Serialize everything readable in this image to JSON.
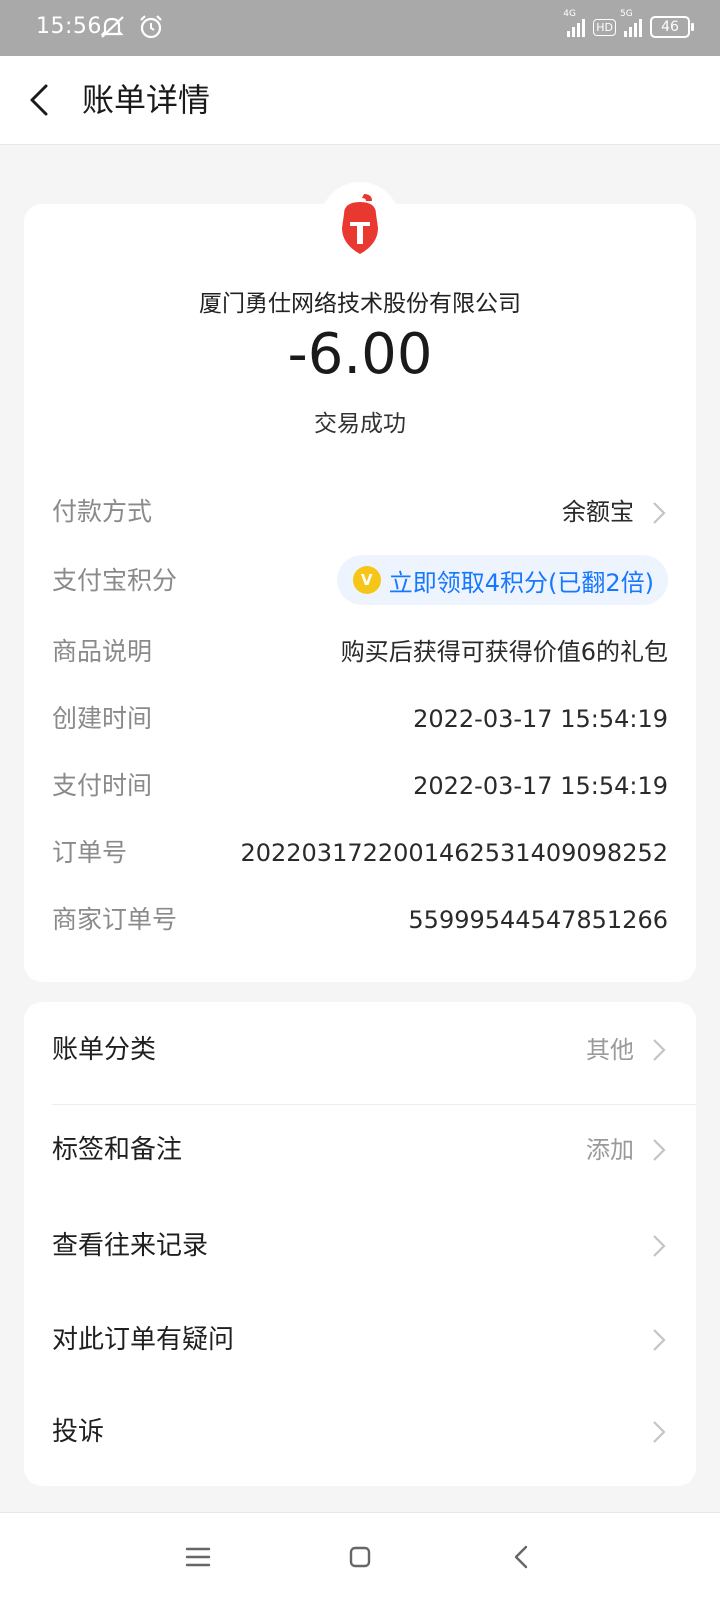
{
  "status_bar": {
    "time": "15:56",
    "network_1": "4G",
    "hd_badge": "HD",
    "network_2": "5G",
    "battery": "46",
    "icons": [
      "mute-icon",
      "alarm-icon",
      "signal-icon",
      "battery-icon"
    ]
  },
  "header": {
    "title": "账单详情",
    "back_icon": "chevron-left-icon"
  },
  "transaction": {
    "merchant": "厦门勇仕网络技术股份有限公司",
    "amount": "-6.00",
    "status": "交易成功",
    "logo_color": "#e8382f"
  },
  "details": {
    "payment_method": {
      "label": "付款方式",
      "value": "余额宝"
    },
    "points": {
      "label": "支付宝积分",
      "value": "立即领取4积分(已翻2倍)",
      "coin_glyph": "V"
    },
    "product_desc": {
      "label": "商品说明",
      "value": "购买后获得可获得价值6的礼包"
    },
    "created_time": {
      "label": "创建时间",
      "value": "2022-03-17 15:54:19"
    },
    "paid_time": {
      "label": "支付时间",
      "value": "2022-03-17 15:54:19"
    },
    "order_no": {
      "label": "订单号",
      "value": "2022031722001462531409098252"
    },
    "merchant_order_no": {
      "label": "商家订单号",
      "value": "55999544547851266"
    }
  },
  "menu": {
    "category": {
      "label": "账单分类",
      "value": "其他"
    },
    "tags_notes": {
      "label": "标签和备注",
      "value": "添加"
    },
    "history": {
      "label": "查看往来记录"
    },
    "question": {
      "label": "对此订单有疑问"
    },
    "complaint": {
      "label": "投诉"
    }
  },
  "colors": {
    "accent_blue": "#1677ff",
    "pill_bg": "#eef4fd",
    "coin": "#f5c518",
    "status_bar": "#a9a9a9"
  }
}
